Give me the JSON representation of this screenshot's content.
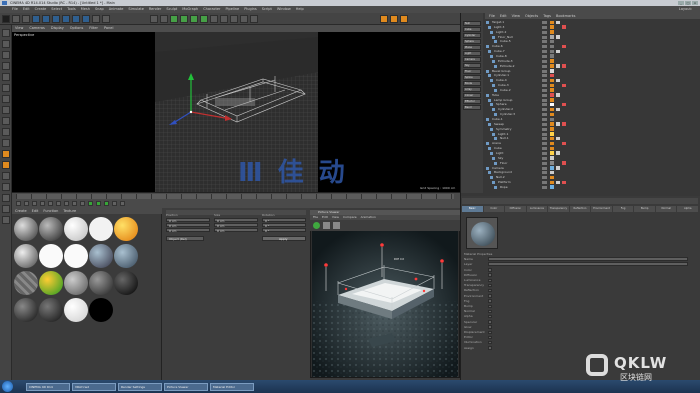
{
  "window": {
    "title": "CINEMA 4D R14.014 Studio (RC - R14) - [Untitled 1 *] - Main"
  },
  "menu": [
    "File",
    "Edit",
    "Create",
    "Select",
    "Tools",
    "Mesh",
    "Snap",
    "Animate",
    "Simulate",
    "Render",
    "Sculpt",
    "MoGraph",
    "Character",
    "Pipeline",
    "Plugins",
    "Script",
    "Window",
    "Help"
  ],
  "layout_label": "Layout:",
  "viewport": {
    "menu": [
      "View",
      "Cameras",
      "Display",
      "Options",
      "Filter",
      "Panel"
    ],
    "label": "Perspective",
    "status": "Grid Spacing : 1000 cm"
  },
  "watermark_text": "Ⅲ 佳 动",
  "materials_menu": [
    "Create",
    "Edit",
    "Function",
    "Texture"
  ],
  "attributes": {
    "labels": [
      "Position",
      "Size",
      "Rotation"
    ],
    "x": [
      "0 cm",
      "0 cm",
      "0 °"
    ],
    "y": [
      "0 cm",
      "0 cm",
      "0 °"
    ],
    "z": [
      "0 cm",
      "0 cm",
      "0 °"
    ],
    "mode": "Object (Rel)",
    "apply": "Apply"
  },
  "picture_viewer": {
    "title": "Picture Viewer",
    "menu": [
      "File",
      "Edit",
      "View",
      "Compare",
      "Animation"
    ],
    "overlay": "DIE CX"
  },
  "object_manager": {
    "menu": [
      "File",
      "Edit",
      "View",
      "Objects",
      "Tags",
      "Bookmarks"
    ],
    "layers": [
      "Null",
      "Cube",
      "Cylinder",
      "Sphere",
      "Plane",
      "Light",
      "Camera",
      "Sky",
      "Floor",
      "Spline",
      "Boole",
      "Array",
      "Cloner",
      "Effector",
      "Bend"
    ],
    "rows": [
      {
        "name": "Target.1",
        "tag": "#e08a1e"
      },
      {
        "name": "Light.3",
        "tag": "#e08a1e"
      },
      {
        "name": "Light.2",
        "tag": "#e08a1e"
      },
      {
        "name": "Floor_Null",
        "tag": "#aaaaaa"
      },
      {
        "name": "Cube.5",
        "tag": "#7a7a7a"
      },
      {
        "name": "Cube.6",
        "tag": "#7a7a7a"
      },
      {
        "name": "Cube.7",
        "tag": "#7a7a7a"
      },
      {
        "name": "Cube.8",
        "tag": "#7a7a7a"
      },
      {
        "name": "Extrude.3",
        "tag": "#e08a1e"
      },
      {
        "name": "Extrude.2",
        "tag": "#e08a1e"
      },
      {
        "name": "Bevel Group",
        "tag": "#d9d9d9"
      },
      {
        "name": "Cylinder.1",
        "tag": "#e05050"
      },
      {
        "name": "Cube.4",
        "tag": "#e08a1e"
      },
      {
        "name": "Cube.3",
        "tag": "#e08a1e"
      },
      {
        "name": "Cube.2",
        "tag": "#e08a1e"
      },
      {
        "name": "Tube",
        "tag": "#e05050"
      },
      {
        "name": "Lamp Group",
        "tag": "#e08a1e"
      },
      {
        "name": "Sphere",
        "tag": "#ffffff"
      },
      {
        "name": "Cylinder.2",
        "tag": "#e08a1e"
      },
      {
        "name": "Cylinder.3",
        "tag": "#e08a1e"
      },
      {
        "name": "Cube.1",
        "tag": "#7a7a7a"
      },
      {
        "name": "Sweep",
        "tag": "#e08a1e"
      },
      {
        "name": "Symmetry",
        "tag": "#e08a1e"
      },
      {
        "name": "Light.1",
        "tag": "#ffd24a"
      },
      {
        "name": "Null.1",
        "tag": "#e08a1e"
      },
      {
        "name": "Arena",
        "tag": "#e08a1e"
      },
      {
        "name": "Cube",
        "tag": "#e08a1e"
      },
      {
        "name": "Light",
        "tag": "#ffd24a"
      },
      {
        "name": "Sky",
        "tag": "#cccccc"
      },
      {
        "name": "Floor",
        "tag": "#888888"
      },
      {
        "name": "Camera",
        "tag": "#6fb0e0"
      },
      {
        "name": "Background",
        "tag": "#cccccc"
      },
      {
        "name": "Null.2",
        "tag": "#e08a1e"
      },
      {
        "name": "Platform",
        "tag": "#e08a1e"
      },
      {
        "name": "Rope",
        "tag": "#6fb0e0"
      }
    ]
  },
  "attr_tabs": [
    "Basic",
    "Color",
    "Diffusion",
    "Luminance",
    "Transparency",
    "Reflection",
    "Environment",
    "Fog",
    "Bump",
    "Normal",
    "Alpha"
  ],
  "attr_rows": [
    "Material Properties",
    "Name",
    "Layer",
    "Color",
    "Diffusion",
    "Luminance",
    "Transparency",
    "Reflection",
    "Environment",
    "Fog",
    "Bump",
    "Normal",
    "Alpha",
    "Specular",
    "Glow",
    "Displacement",
    "Editor",
    "Illumination",
    "Assign"
  ],
  "taskbar": [
    "CINEMA 4D R14",
    "VRAY.cwd",
    "Render Settings",
    "Picture Viewer",
    "Material Editor"
  ],
  "logo": {
    "big": "QKLW",
    "small": "区块链网"
  }
}
